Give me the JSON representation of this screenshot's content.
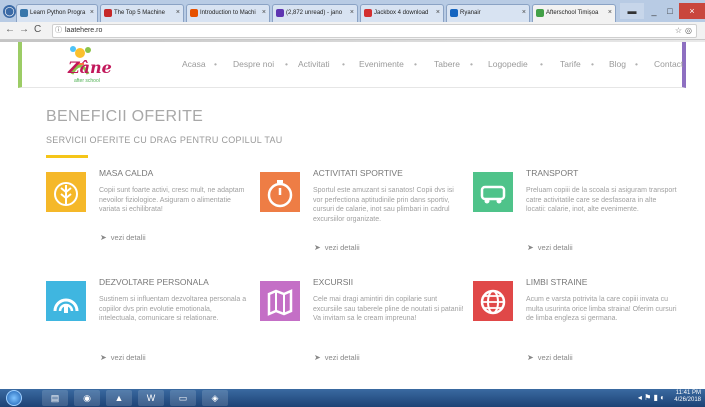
{
  "browser": {
    "tabs": [
      {
        "label": "Learn Python Progra",
        "favicon_color": "#3776ab"
      },
      {
        "label": "The Top 5 Machine",
        "favicon_color": "#c62828"
      },
      {
        "label": "Introduction to Machi",
        "favicon_color": "#e65100"
      },
      {
        "label": "(2,872 unread) - jano",
        "favicon_color": "#5e35b1"
      },
      {
        "label": "Jackbox 4 download",
        "favicon_color": "#d32f2f"
      },
      {
        "label": "Ryanair",
        "favicon_color": "#1565c0"
      },
      {
        "label": "Afterschool Timișoa",
        "favicon_color": "#43a047"
      }
    ],
    "url": "laatehere.ro",
    "close_symbol": "×"
  },
  "site": {
    "logo_text": "Zâne",
    "logo_sub": "after school",
    "nav": [
      "Acasa",
      "Despre noi",
      "Activitati",
      "Evenimente",
      "Tabere",
      "Logopedie",
      "Tarife",
      "Blog",
      "Contact"
    ],
    "nav_separator": "•"
  },
  "section": {
    "title": "BENEFICII OFERITE",
    "subtitle": "SERVICII OFERITE CU DRAG PENTRU COPILUL TAU",
    "accent_color": "#f5c518"
  },
  "services": [
    {
      "title": "MASA CALDA",
      "color": "#f5b829",
      "icon": "leaf-icon",
      "desc": "Copii sunt foarte activi, cresc mult, ne adaptam nevoilor fiziologice. Asiguram o alimentatie variata si echilibrata!",
      "more": "vezi detalii"
    },
    {
      "title": "ACTIVITATI SPORTIVE",
      "color": "#ee7d45",
      "icon": "stopwatch-icon",
      "desc": "Sportul este amuzant si sanatos! Copii dvs isi vor perfectiona aptitudinile prin dans sportiv, cursuri de calarie, inot sau plimbari in cadrul excursiilor organizate.",
      "more": "vezi detalii"
    },
    {
      "title": "TRANSPORT",
      "color": "#4fc38a",
      "icon": "car-icon",
      "desc": "Preluam copiii de la scoala si asiguram transport catre activitatile care se desfasoara in alte locatii: calarie, inot, alte evenimente.",
      "more": "vezi detalii"
    },
    {
      "title": "DEZVOLTARE PERSONALA",
      "color": "#3fb6e0",
      "icon": "gauge-icon",
      "desc": "Sustinem si influentam dezvoltarea personala a copiilor dvs prin evolutie emotionala, intelectuala, comunicare si relationare.",
      "more": "vezi detalii"
    },
    {
      "title": "EXCURSII",
      "color": "#c46fc6",
      "icon": "map-icon",
      "desc": "Cele mai dragi amintiri din copilarie sunt excursiile sau taberele pline de noutati si patanii! Va invitam sa le cream impreuna!",
      "more": "vezi detalii"
    },
    {
      "title": "LIMBI STRAINE",
      "color": "#e04848",
      "icon": "globe-icon",
      "desc": "Acum e varsta potrivita la care copiii invata cu multa usurinta orice limba straina! Oferim cursuri de limba engleza si germana.",
      "more": "vezi detalii"
    }
  ],
  "taskbar": {
    "time": "11:41 PM",
    "date": "4/26/2018"
  }
}
